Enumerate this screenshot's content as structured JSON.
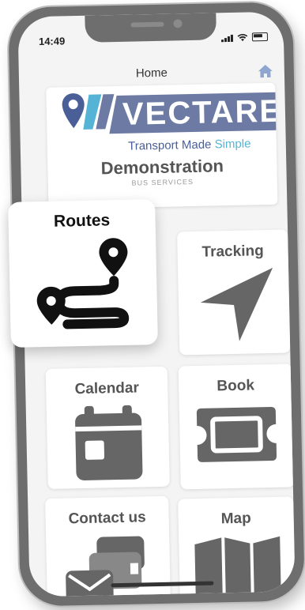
{
  "status_bar": {
    "time": "14:49"
  },
  "nav": {
    "title": "Home"
  },
  "brand": {
    "name": "VECTARE",
    "tagline_main": "Transport Made ",
    "tagline_accent": "Simple",
    "heading": "Demonstration",
    "subheading": "BUS SERVICES",
    "colors": {
      "band": "#6c7aa4",
      "accent": "#55b4d6",
      "mark": "#4a5f98"
    }
  },
  "tiles": {
    "routes": {
      "label": "Routes",
      "icon": "route-icon"
    },
    "tracking": {
      "label": "Tracking",
      "icon": "navigation-arrow-icon"
    },
    "calendar": {
      "label": "Calendar",
      "icon": "calendar-icon"
    },
    "book": {
      "label": "Book",
      "icon": "ticket-icon"
    },
    "contact": {
      "label": "Contact us",
      "icon": "mail-icon"
    },
    "map": {
      "label": "Map",
      "icon": "map-icon"
    }
  }
}
